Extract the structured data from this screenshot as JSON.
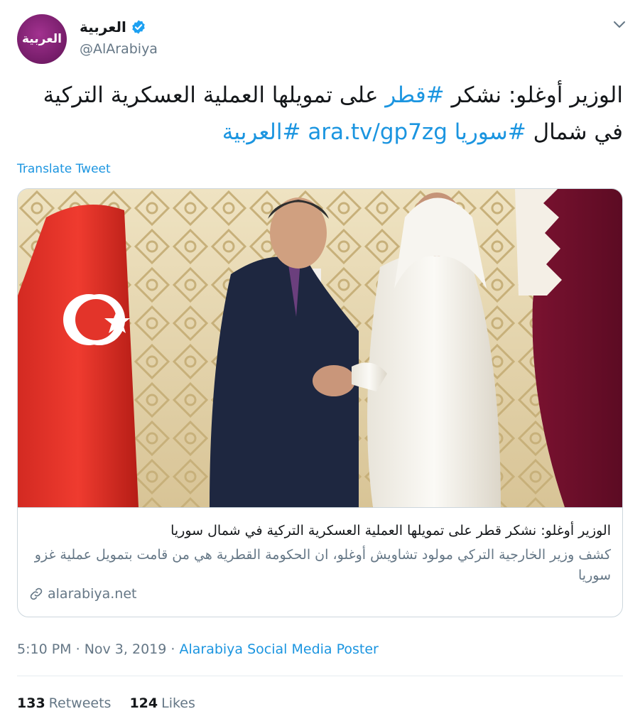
{
  "account": {
    "avatar_text": "العربية",
    "display_name": "العربية",
    "handle": "@AlArabiya",
    "verified": true
  },
  "tweet": {
    "text_plain_1": "الوزير أوغلو: نشكر ",
    "hashtag_qatar": "#قطر",
    "text_plain_2": " على تمويلها العملية العسكرية التركية في شمال ",
    "hashtag_syria": "#سوريا",
    "url": "ara.tv/gp7zg",
    "hashtag_alarabiya": "#العربية"
  },
  "translate_label": "Translate Tweet",
  "card": {
    "title": "الوزير أوغلو: نشكر قطر على تمويلها العملية العسكرية التركية في شمال سوريا",
    "description": "كشف وزير الخارجية التركي مولود تشاويش أوغلو، ان الحكومة القطرية هي من قامت بتمويل عملية غزو سوريا",
    "domain": "alarabiya.net"
  },
  "meta": {
    "time": "5:10 PM",
    "separator": " · ",
    "date": "Nov 3, 2019",
    "source": "Alarabiya Social Media Poster"
  },
  "stats": {
    "retweets_count": "133",
    "retweets_label": "Retweets",
    "likes_count": "124",
    "likes_label": "Likes"
  },
  "colors": {
    "link": "#1b95e0",
    "secondary_text": "#657786",
    "avatar": "#7b1f6e",
    "verified": "#1da1f2"
  }
}
